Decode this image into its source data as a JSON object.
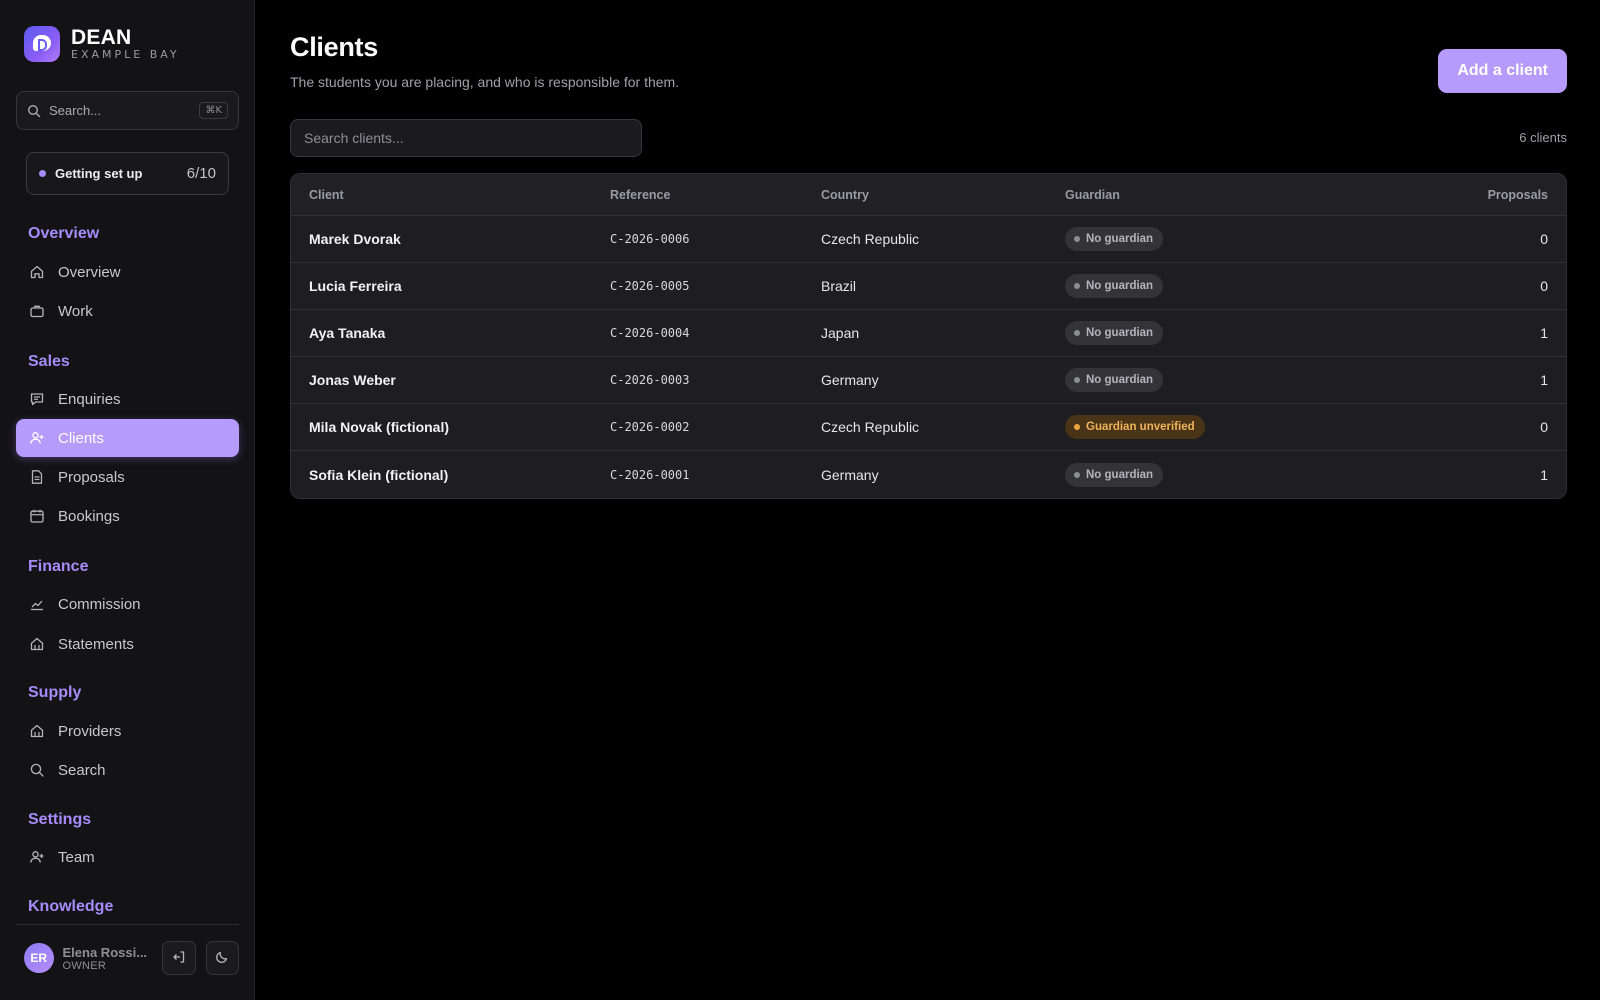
{
  "brand": {
    "name": "DEAN",
    "subtitle": "EXAMPLE BAY"
  },
  "sidebar": {
    "search_placeholder": "Search...",
    "search_shortcut": "⌘K",
    "setup": {
      "label": "Getting set up",
      "progress": "6/10"
    },
    "sections": {
      "overview": "Overview",
      "sales": "Sales",
      "finance": "Finance",
      "supply": "Supply",
      "settings": "Settings",
      "knowledge": "Knowledge"
    },
    "items": {
      "overview": "Overview",
      "work": "Work",
      "enquiries": "Enquiries",
      "clients": "Clients",
      "proposals": "Proposals",
      "bookings": "Bookings",
      "commission": "Commission",
      "statements": "Statements",
      "providers": "Providers",
      "search": "Search",
      "team": "Team"
    },
    "active_item": "clients",
    "user": {
      "initials": "ER",
      "name": "Elena Rossi...",
      "role": "OWNER"
    }
  },
  "main": {
    "title": "Clients",
    "subtitle": "The students you are placing, and who is responsible for them.",
    "add_button": "Add a client",
    "search_placeholder": "Search clients...",
    "count_label": "6 clients",
    "table": {
      "columns": {
        "client": "Client",
        "reference": "Reference",
        "country": "Country",
        "guardian": "Guardian",
        "proposals": "Proposals"
      },
      "rows": [
        {
          "client": "Marek Dvorak",
          "reference": "C-2026-0006",
          "country": "Czech Republic",
          "guardian": "No guardian",
          "guardian_status": "none",
          "proposals": "0"
        },
        {
          "client": "Lucia Ferreira",
          "reference": "C-2026-0005",
          "country": "Brazil",
          "guardian": "No guardian",
          "guardian_status": "none",
          "proposals": "0"
        },
        {
          "client": "Aya Tanaka",
          "reference": "C-2026-0004",
          "country": "Japan",
          "guardian": "No guardian",
          "guardian_status": "none",
          "proposals": "1"
        },
        {
          "client": "Jonas Weber",
          "reference": "C-2026-0003",
          "country": "Germany",
          "guardian": "No guardian",
          "guardian_status": "none",
          "proposals": "1"
        },
        {
          "client": "Mila Novak (fictional)",
          "reference": "C-2026-0002",
          "country": "Czech Republic",
          "guardian": "Guardian unverified",
          "guardian_status": "unverified",
          "proposals": "0"
        },
        {
          "client": "Sofia Klein (fictional)",
          "reference": "C-2026-0001",
          "country": "Germany",
          "guardian": "No guardian",
          "guardian_status": "none",
          "proposals": "1"
        }
      ]
    }
  },
  "colors": {
    "accent": "#b69afc",
    "section_label": "#a78bfa",
    "warn_badge_text": "#f0b35a",
    "warn_badge_bg": "#4a3418"
  }
}
